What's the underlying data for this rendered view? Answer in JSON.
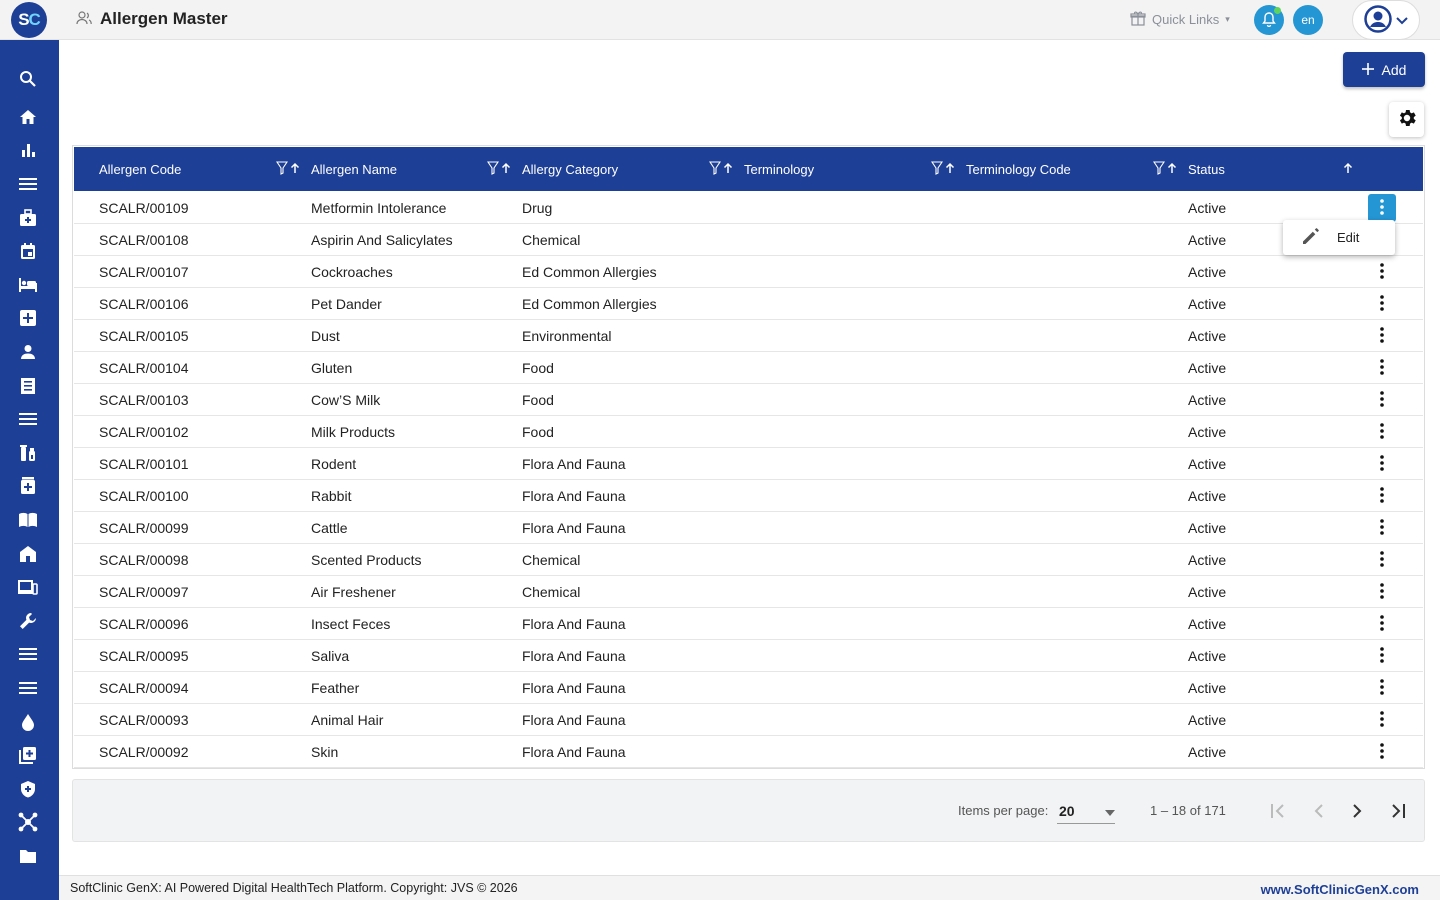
{
  "app": {
    "logo_s": "S",
    "logo_c": "C",
    "title": "Allergen Master"
  },
  "topbar": {
    "quick_links": "Quick Links",
    "lang": "en"
  },
  "toolbar": {
    "add_label": "Add"
  },
  "table": {
    "columns": [
      "Allergen Code",
      "Allergen Name",
      "Allergy Category",
      "Terminology",
      "Terminology Code",
      "Status"
    ],
    "rows": [
      [
        "SCALR/00109",
        "Metformin Intolerance",
        "Drug",
        "",
        "",
        "Active"
      ],
      [
        "SCALR/00108",
        "Aspirin And Salicylates",
        "Chemical",
        "",
        "",
        "Active"
      ],
      [
        "SCALR/00107",
        "Cockroaches",
        "Ed Common Allergies",
        "",
        "",
        "Active"
      ],
      [
        "SCALR/00106",
        "Pet Dander",
        "Ed Common Allergies",
        "",
        "",
        "Active"
      ],
      [
        "SCALR/00105",
        "Dust",
        "Environmental",
        "",
        "",
        "Active"
      ],
      [
        "SCALR/00104",
        "Gluten",
        "Food",
        "",
        "",
        "Active"
      ],
      [
        "SCALR/00103",
        "Cow’S Milk",
        "Food",
        "",
        "",
        "Active"
      ],
      [
        "SCALR/00102",
        "Milk Products",
        "Food",
        "",
        "",
        "Active"
      ],
      [
        "SCALR/00101",
        "Rodent",
        "Flora And Fauna",
        "",
        "",
        "Active"
      ],
      [
        "SCALR/00100",
        "Rabbit",
        "Flora And Fauna",
        "",
        "",
        "Active"
      ],
      [
        "SCALR/00099",
        "Cattle",
        "Flora And Fauna",
        "",
        "",
        "Active"
      ],
      [
        "SCALR/00098",
        "Scented Products",
        "Chemical",
        "",
        "",
        "Active"
      ],
      [
        "SCALR/00097",
        "Air Freshener",
        "Chemical",
        "",
        "",
        "Active"
      ],
      [
        "SCALR/00096",
        "Insect Feces",
        "Flora And Fauna",
        "",
        "",
        "Active"
      ],
      [
        "SCALR/00095",
        "Saliva",
        "Flora And Fauna",
        "",
        "",
        "Active"
      ],
      [
        "SCALR/00094",
        "Feather",
        "Flora And Fauna",
        "",
        "",
        "Active"
      ],
      [
        "SCALR/00093",
        "Animal Hair",
        "Flora And Fauna",
        "",
        "",
        "Active"
      ],
      [
        "SCALR/00092",
        "Skin",
        "Flora And Fauna",
        "",
        "",
        "Active"
      ]
    ]
  },
  "row_menu": {
    "edit_label": "Edit"
  },
  "paginator": {
    "items_per_page_label": "Items per page:",
    "page_size": "20",
    "range": "1 – 18 of 171"
  },
  "footer": {
    "left": "SoftClinic GenX: AI Powered Digital HealthTech Platform. Copyright: JVS © 2026",
    "right": "www.SoftClinicGenX.com"
  },
  "sidebar_icons": [
    "search-icon",
    "home-icon",
    "bar-chart-icon",
    "menu-icon",
    "medical-bag-icon",
    "calendar-icon",
    "bed-icon",
    "first-aid-icon",
    "person-icon",
    "document-icon",
    "list-icon",
    "lab-icon",
    "pharmacy-icon",
    "book-icon",
    "building-icon",
    "devices-icon",
    "wrench-icon",
    "list-alt-icon",
    "menu-alt-icon",
    "blood-drop-icon",
    "add-box-icon",
    "shield-icon",
    "network-icon",
    "folder-icon"
  ],
  "colors": {
    "primary": "#1e3f96",
    "accent": "#2596d4",
    "link": "#1e3f96"
  }
}
